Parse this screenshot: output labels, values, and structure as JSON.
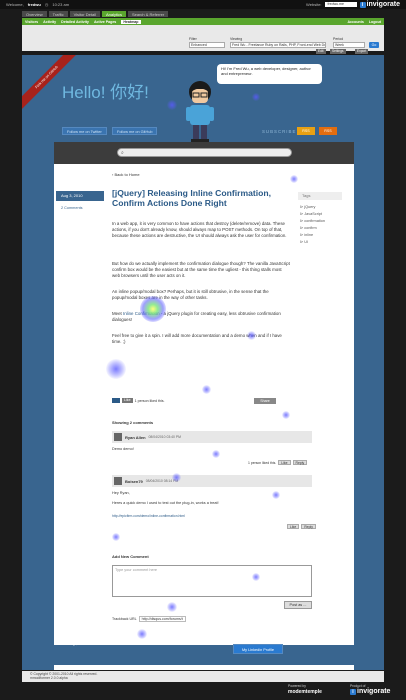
{
  "topbar": {
    "welcome": "Welcome,",
    "user": "fredwu",
    "time": "10:23 am",
    "website_label": "Website:",
    "website_value": "fredwu.me",
    "brand": "invigorate"
  },
  "tabs": [
    {
      "label": "Overview",
      "active": false
    },
    {
      "label": "Traffic",
      "active": false
    },
    {
      "label": "Visitor Detail",
      "active": false
    },
    {
      "label": "Analytics",
      "active": true
    },
    {
      "label": "Search & Referrer",
      "active": false
    }
  ],
  "subnav": {
    "items": [
      "Visitors",
      "Activity",
      "Detailed Activity",
      "Active Pages"
    ],
    "current": "Heatmap",
    "right": [
      "Accounts",
      "Logout"
    ]
  },
  "filters": {
    "filter_label": "Filter",
    "filter_value": "Enhanced",
    "viewing_label": "Viewing",
    "viewing_value": "Fred Wu - Freelance Ruby on Rails, PHP, Front-end Web Developer",
    "period_label": "Period",
    "period_value": "Week",
    "go": "Go",
    "toolbar": [
      "Edit",
      "Settings",
      "Export"
    ]
  },
  "site": {
    "ribbon": "Fork me on GitHub",
    "hello": "Hello! 你好!",
    "bubble": "Hi! I'm Fred Wu, a web developer, designer, author and entrepreneur.",
    "follow_twitter": "Follow me on Twitter",
    "follow_github": "Follow me on GitHub",
    "subscribe": "SUBSCRIBE",
    "rss_a": "RSS",
    "rss_b": "RSS",
    "back": "Back to Home",
    "date": "Aug 3, 2010",
    "comments_count": "2 Comments",
    "title": "[jQuery] Releasing Inline Confirmation, Confirm Actions Done Right",
    "p1": "In a web app, it is very common to have actions that destroy (delete/remove) data. These actions, if you don't already know, should always map to POST methods. On top of that, because these actions are destructive, the UI should always ask the user for confirmation.",
    "p2": "But how do we actually implement the confirmation dialogue though? The vanilla JavaScript confirm box would be the easiest but at the same time the ugliest - this thing stalls most web browsers until the user acts on it.",
    "p3": "An inline popup/modal box? Perhaps, but it is still obtrusive, in the sense that the popup/modal boxes are in the way of other tasks.",
    "p4_pre": "Meet ",
    "p4_link": "Inline Confirmation",
    "p4_post": " - a jQuery plugin for creating easy, less obtrusive confirmation dialogues!",
    "p5": "Feel free to give it a spin. I will add more documentation and a demo when and if I have time. ;)",
    "tags_heading": "Tags",
    "tags": [
      "jQuery",
      "JavaScript",
      "confirmation",
      "confirm",
      "inline",
      "UI"
    ],
    "like": "Like",
    "liked": "1 person liked this.",
    "share": "Share",
    "showing_comments": "Showing 2 comments",
    "comments": [
      {
        "name": "Ryan Allen",
        "time": "08/04/2010 03:40 PM",
        "text": "Demo demo!",
        "likes": "1 person liked this.",
        "like": "Like",
        "reply": "Reply"
      },
      {
        "name": "Boisen79",
        "time": "08/04/2010 08:14 PM",
        "text": "Hey Ryan,",
        "text2": "Heres a quick demo I used to test out the plug-in, works a treat!",
        "link": "http://epicfirm.com/demo/inline-confirmation.html",
        "like": "Like",
        "reply": "Reply"
      }
    ],
    "add_comment": "Add New Comment",
    "comment_placeholder": "Type your comment here",
    "post_as": "Post as ...",
    "trackback_label": "Trackback URL",
    "trackback_value": "http://disqus.com/forums/t",
    "who": "Who am I?",
    "contact": "My Linkedin Profile"
  },
  "footer": {
    "copyright": "© Copyright © 2001-2010 All rights reserved.",
    "version": "mmodiformer 2.0.0 alpha",
    "powered_by": "Powered by",
    "company": "modemtemple",
    "product_of": "Product of",
    "brand": "invigorate"
  },
  "accent": "#5aa62e",
  "page_blue": "#39658f"
}
